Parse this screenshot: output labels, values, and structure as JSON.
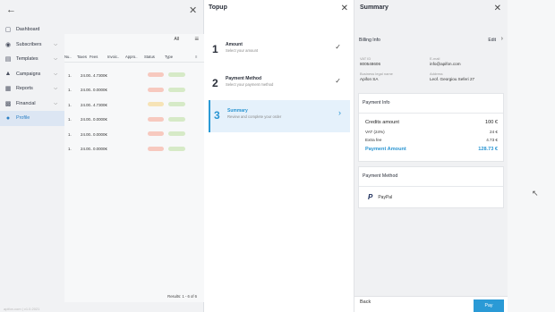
{
  "app": {
    "back_icon": "arrow-left-icon",
    "close_icon": "close-icon",
    "nav": [
      {
        "label": "Dashboard",
        "icon": "dashboard-icon",
        "chevron": false,
        "active": false
      },
      {
        "label": "Subscribers",
        "icon": "people-icon",
        "chevron": true,
        "active": false
      },
      {
        "label": "Templates",
        "icon": "document-icon",
        "chevron": true,
        "active": false
      },
      {
        "label": "Campaigns",
        "icon": "megaphone-icon",
        "chevron": true,
        "active": false
      },
      {
        "label": "Reports",
        "icon": "chart-icon",
        "chevron": true,
        "active": false
      },
      {
        "label": "Financial",
        "icon": "wallet-icon",
        "chevron": true,
        "active": false
      },
      {
        "label": "Profile",
        "icon": "user-icon",
        "chevron": false,
        "active": true
      }
    ],
    "filter_value": "All",
    "table": {
      "headers": [
        "Nu..",
        "Taxes",
        "Fees",
        "Invoic..",
        "Appro..",
        "Status",
        "Type",
        "",
        "≡"
      ],
      "rows": [
        {
          "n": "1.",
          "date": "24.00..",
          "fee": "4.7300€",
          "status_color": "#f7c9bf",
          "type_color": "#d6eac7"
        },
        {
          "n": "1.",
          "date": "24.00..",
          "fee": "0.0000€",
          "status_color": "#f7c9bf",
          "type_color": "#d6eac7"
        },
        {
          "n": "1.",
          "date": "24.00..",
          "fee": "4.7300€",
          "status_color": "#f6e3b6",
          "type_color": "#d6eac7"
        },
        {
          "n": "1.",
          "date": "24.00..",
          "fee": "0.0000€",
          "status_color": "#f7c9bf",
          "type_color": "#d6eac7"
        },
        {
          "n": "1.",
          "date": "24.00..",
          "fee": "0.0000€",
          "status_color": "#f7c9bf",
          "type_color": "#d6eac7"
        },
        {
          "n": "1.",
          "date": "24.00..",
          "fee": "0.0000€",
          "status_color": "#f7c9bf",
          "type_color": "#d6eac7"
        }
      ]
    },
    "results_text": "Results: 1 - 6 of 6",
    "version_text": "apifon.com | v1.0.2021"
  },
  "topup": {
    "title": "Topup",
    "steps": [
      {
        "num": "1",
        "title": "Amount",
        "desc": "Select your amount",
        "mark": "✓",
        "active": false
      },
      {
        "num": "2",
        "title": "Payment Method",
        "desc": "Select your payment method",
        "mark": "✓",
        "active": false
      },
      {
        "num": "3",
        "title": "Summary",
        "desc": "Review and complete your order",
        "mark": "›",
        "active": true
      }
    ]
  },
  "summary": {
    "title": "Summary",
    "billing": {
      "heading": "Billing Info",
      "edit_label": "Edit",
      "vat_label": "VAT ID",
      "vat_value": "800548606",
      "email_label": "E-mail",
      "email_value": "info@apifon.com",
      "legal_label": "Business legal name",
      "legal_value": "Apifon SA",
      "address_label": "Address",
      "address_value": "Leof. Georgiou Seferi 27"
    },
    "payment_info": {
      "heading": "Payment Info",
      "credits_label": "Credits amount",
      "credits_value": "100 €",
      "vat_label": "VAT (24%)",
      "vat_value": "24 €",
      "fee_label": "Extra fee",
      "fee_value": "4.73 €",
      "total_label": "Payment Amount",
      "total_value": "128.73 €"
    },
    "payment_method": {
      "heading": "Payment Method",
      "method_name": "PayPal"
    },
    "back_label": "Back",
    "pay_label": "Pay"
  },
  "colors": {
    "accent": "#2a9ad6",
    "active_step_bg": "#e5f1fb"
  }
}
